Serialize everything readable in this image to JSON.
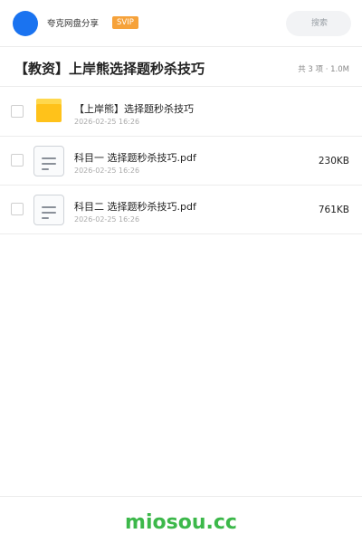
{
  "header": {
    "app_name": "夸克网盘分享",
    "badge": "SVIP",
    "search_placeholder": "搜索",
    "avatar_color": "#1a73f0"
  },
  "share": {
    "title": "【教资】上岸熊选择题秒杀技巧",
    "summary": "共 3 项 · 1.0M"
  },
  "files": [
    {
      "name": "【上岸熊】选择题秒杀技巧",
      "date": "2026-02-25 16:26",
      "size": "",
      "type": "folder-icon"
    },
    {
      "name": "科目一 选择题秒杀技巧.pdf",
      "date": "2026-02-25 16:26",
      "size": "230KB",
      "type": "document-icon"
    },
    {
      "name": "科目二 选择题秒杀技巧.pdf",
      "date": "2026-02-25 16:26",
      "size": "761KB",
      "type": "document-icon"
    }
  ],
  "footer": {
    "brand": "miosou.cc",
    "brand_color": "#3cb84a"
  }
}
